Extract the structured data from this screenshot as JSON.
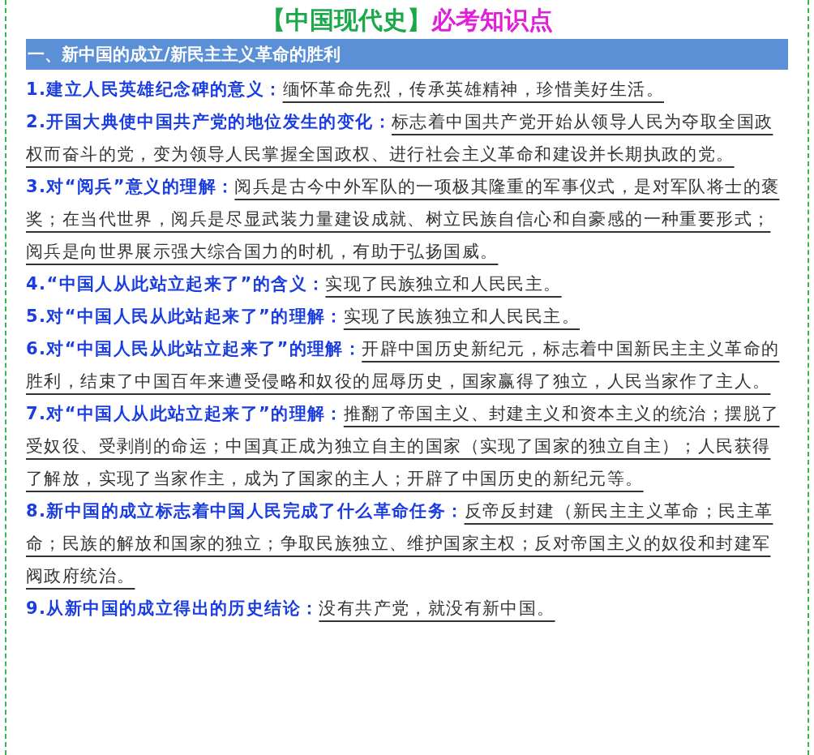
{
  "title": {
    "bracketed": "【中国现代史】",
    "highlight": "必考知识点"
  },
  "section": {
    "heading": "一、新中国的成立/新民主主义革命的胜利"
  },
  "items": [
    {
      "label": "1.建立人民英雄纪念碑的意义：",
      "text": "缅怀革命先烈，传承英雄精神，珍惜美好生活。"
    },
    {
      "label": "2.开国大典使中国共产党的地位发生的变化：",
      "text": "标志着中国共产党开始从领导人民为夺取全国政权而奋斗的党，变为领导人民掌握全国政权、进行社会主义革命和建设并长期执政的党。"
    },
    {
      "label": "3.对“阅兵”意义的理解：",
      "text": "阅兵是古今中外军队的一项极其隆重的军事仪式，是对军队将士的褒奖；在当代世界，阅兵是尽显武装力量建设成就、树立民族自信心和自豪感的一种重要形式；阅兵是向世界展示强大综合国力的时机，有助于弘扬国威。"
    },
    {
      "label": "4.“中国人从此站立起来了”的含义：",
      "text": "实现了民族独立和人民民主。"
    },
    {
      "label": "5.对“中国人民从此站起来了”的理解：",
      "text": "实现了民族独立和人民民主。"
    },
    {
      "label": "6.对“中国人民从此站立起来了”的理解：",
      "text": "开辟中国历史新纪元，标志着中国新民主主义革命的胜利，结束了中国百年来遭受侵略和奴役的屈辱历史，国家赢得了独立，人民当家作了主人。"
    },
    {
      "label": "7.对“中国人从此站立起来了”的理解：",
      "text": "推翻了帝国主义、封建主义和资本主义的统治；摆脱了受奴役、受剥削的命运；中国真正成为独立自主的国家（实现了国家的独立自主）；人民获得了解放，实现了当家作主，成为了国家的主人；开辟了中国历史的新纪元等。"
    },
    {
      "label": "8.新中国的成立标志着中国人民完成了什么革命任务：",
      "text": "反帝反封建（新民主主义革命；民主革命；民族的解放和国家的独立；争取民族独立、维护国家主权；反对帝国主义的奴役和封建军阀政府统治。"
    },
    {
      "label": "9.从新中国的成立得出的历史结论：",
      "text": "没有共产党，就没有新中国。"
    }
  ]
}
